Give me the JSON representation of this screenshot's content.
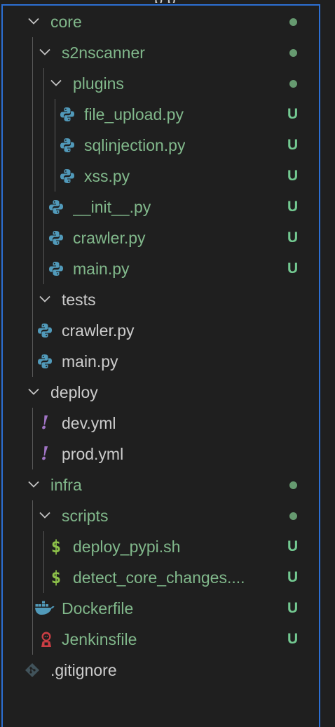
{
  "top_clipped_text": "p p",
  "tree": [
    {
      "label": "core",
      "type": "folder",
      "status": "dot",
      "green": true,
      "icon": "chevron-down-icon"
    },
    {
      "label": "s2nscanner",
      "type": "folder",
      "status": "dot",
      "green": true,
      "icon": "chevron-down-icon"
    },
    {
      "label": "plugins",
      "type": "folder",
      "status": "dot",
      "green": true,
      "icon": "chevron-down-icon"
    },
    {
      "label": "file_upload.py",
      "type": "file",
      "status": "U",
      "green": true,
      "icon": "python-icon"
    },
    {
      "label": "sqlinjection.py",
      "type": "file",
      "status": "U",
      "green": true,
      "icon": "python-icon"
    },
    {
      "label": "xss.py",
      "type": "file",
      "status": "U",
      "green": true,
      "icon": "python-icon"
    },
    {
      "label": "__init__.py",
      "type": "file",
      "status": "U",
      "green": true,
      "icon": "python-icon"
    },
    {
      "label": "crawler.py",
      "type": "file",
      "status": "U",
      "green": true,
      "icon": "python-icon"
    },
    {
      "label": "main.py",
      "type": "file",
      "status": "U",
      "green": true,
      "icon": "python-icon"
    },
    {
      "label": "tests",
      "type": "folder",
      "status": "",
      "green": false,
      "icon": "chevron-down-icon"
    },
    {
      "label": "crawler.py",
      "type": "file",
      "status": "",
      "green": false,
      "icon": "python-icon"
    },
    {
      "label": "main.py",
      "type": "file",
      "status": "",
      "green": false,
      "icon": "python-icon"
    },
    {
      "label": "deploy",
      "type": "folder",
      "status": "",
      "green": false,
      "icon": "chevron-down-icon"
    },
    {
      "label": "dev.yml",
      "type": "file",
      "status": "",
      "green": false,
      "icon": "yaml-icon"
    },
    {
      "label": "prod.yml",
      "type": "file",
      "status": "",
      "green": false,
      "icon": "yaml-icon"
    },
    {
      "label": "infra",
      "type": "folder",
      "status": "dot",
      "green": true,
      "icon": "chevron-down-icon"
    },
    {
      "label": "scripts",
      "type": "folder",
      "status": "dot",
      "green": true,
      "icon": "chevron-down-icon"
    },
    {
      "label": "deploy_pypi.sh",
      "type": "file",
      "status": "U",
      "green": true,
      "icon": "shell-icon"
    },
    {
      "label": "detect_core_changes....",
      "type": "file",
      "status": "U",
      "green": true,
      "icon": "shell-icon"
    },
    {
      "label": "Dockerfile",
      "type": "file",
      "status": "U",
      "green": true,
      "icon": "docker-icon"
    },
    {
      "label": "Jenkinsfile",
      "type": "file",
      "status": "U",
      "green": true,
      "icon": "jenkins-icon"
    },
    {
      "label": ".gitignore",
      "type": "file",
      "status": "",
      "green": false,
      "icon": "git-icon"
    }
  ],
  "colors": {
    "background": "#1f1f1f",
    "untracked_green": "#81b88b",
    "status_green": "#73c991",
    "focus_border": "#2c6fd3",
    "plain_text": "#cccccc"
  }
}
